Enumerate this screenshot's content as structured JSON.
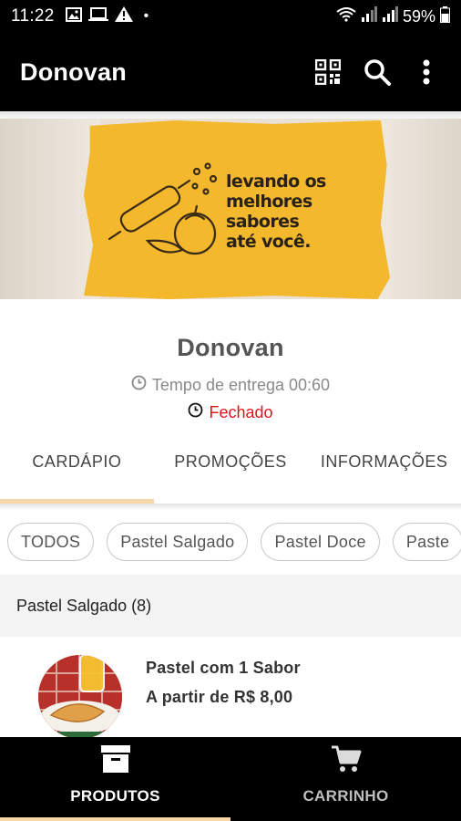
{
  "status_bar": {
    "time": "11:22",
    "battery": "59%",
    "icons": [
      "image-icon",
      "laptop-icon",
      "warning-icon",
      "wifi-icon",
      "signal-icon",
      "signal-icon",
      "battery-icon"
    ],
    "dot": "•"
  },
  "app_bar": {
    "title": "Donovan",
    "actions": [
      "qr-code-icon",
      "search-icon",
      "more-vert-icon"
    ]
  },
  "banner": {
    "line1": "levando os",
    "line2": "melhores",
    "line3": "sabores",
    "line4": "até você."
  },
  "store": {
    "name": "Donovan",
    "delivery_time": "Tempo de entrega 00:60",
    "status": "Fechado"
  },
  "tabs": [
    {
      "label": "CARDÁPIO",
      "active": true
    },
    {
      "label": "PROMOÇÕES",
      "active": false
    },
    {
      "label": "INFORMAÇÕES",
      "active": false
    }
  ],
  "chips": [
    "TODOS",
    "Pastel Salgado",
    "Pastel Doce",
    "Paste"
  ],
  "section": {
    "title": "Pastel Salgado (8)"
  },
  "product": {
    "name": "Pastel com 1 Sabor",
    "price": "A partir de R$ 8,00"
  },
  "bottom_nav": [
    {
      "label": "PRODUTOS",
      "icon": "archive-box-icon",
      "active": true
    },
    {
      "label": "CARRINHO",
      "icon": "cart-icon",
      "active": false
    }
  ],
  "colors": {
    "bar_background": "#000000",
    "closed_status": "#e0141e",
    "accent_indicator": "#f7d9a8",
    "banner_yellow": "#f4b82c"
  }
}
